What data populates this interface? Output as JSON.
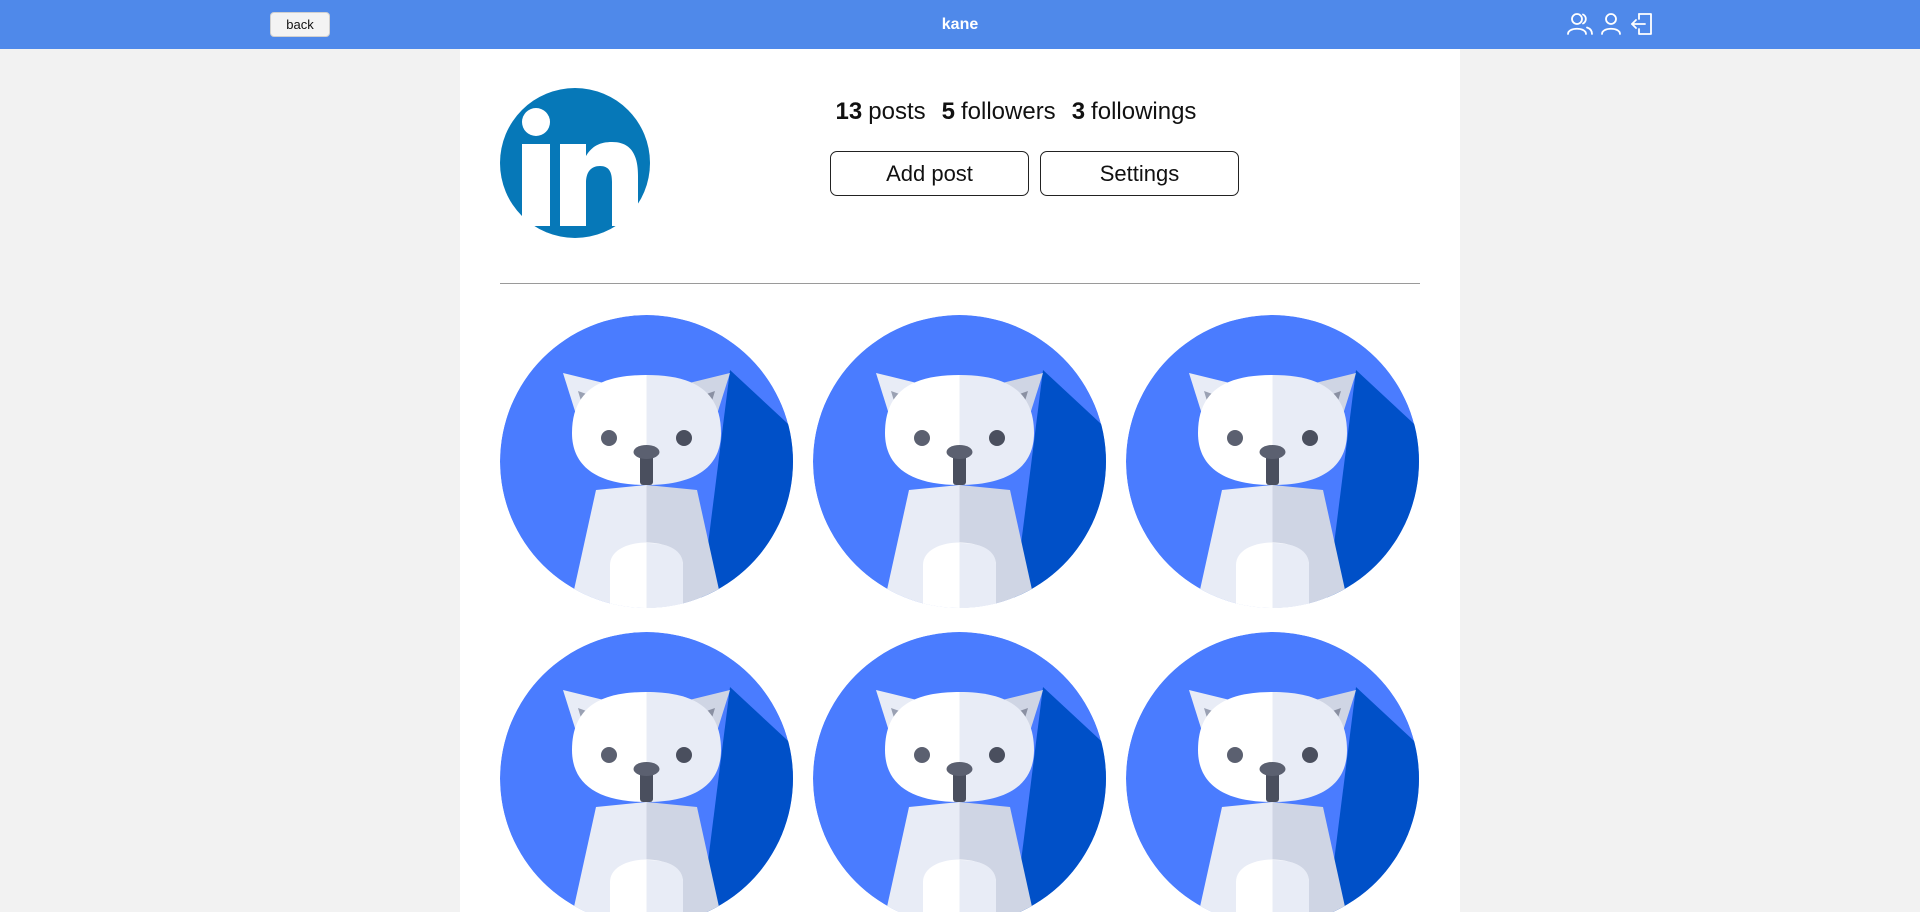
{
  "header": {
    "back_label": "back",
    "title": "kane",
    "icons": [
      "users-icon",
      "user-icon",
      "logout-icon"
    ]
  },
  "profile": {
    "avatar_text": "in",
    "stats": {
      "posts_count": "13",
      "posts_label": "posts",
      "followers_count": "5",
      "followers_label": "followers",
      "followings_count": "3",
      "followings_label": "followings"
    },
    "add_post_label": "Add post",
    "settings_label": "Settings"
  },
  "colors": {
    "header": "#4f89ea",
    "linkedin_blue": "#0678b8",
    "cat_bg": "#4a7cff",
    "cat_shadow": "#0050c8"
  },
  "posts": [
    {
      "image": "cat-avatar"
    },
    {
      "image": "cat-avatar"
    },
    {
      "image": "cat-avatar"
    },
    {
      "image": "cat-avatar"
    },
    {
      "image": "cat-avatar"
    },
    {
      "image": "cat-avatar"
    }
  ]
}
